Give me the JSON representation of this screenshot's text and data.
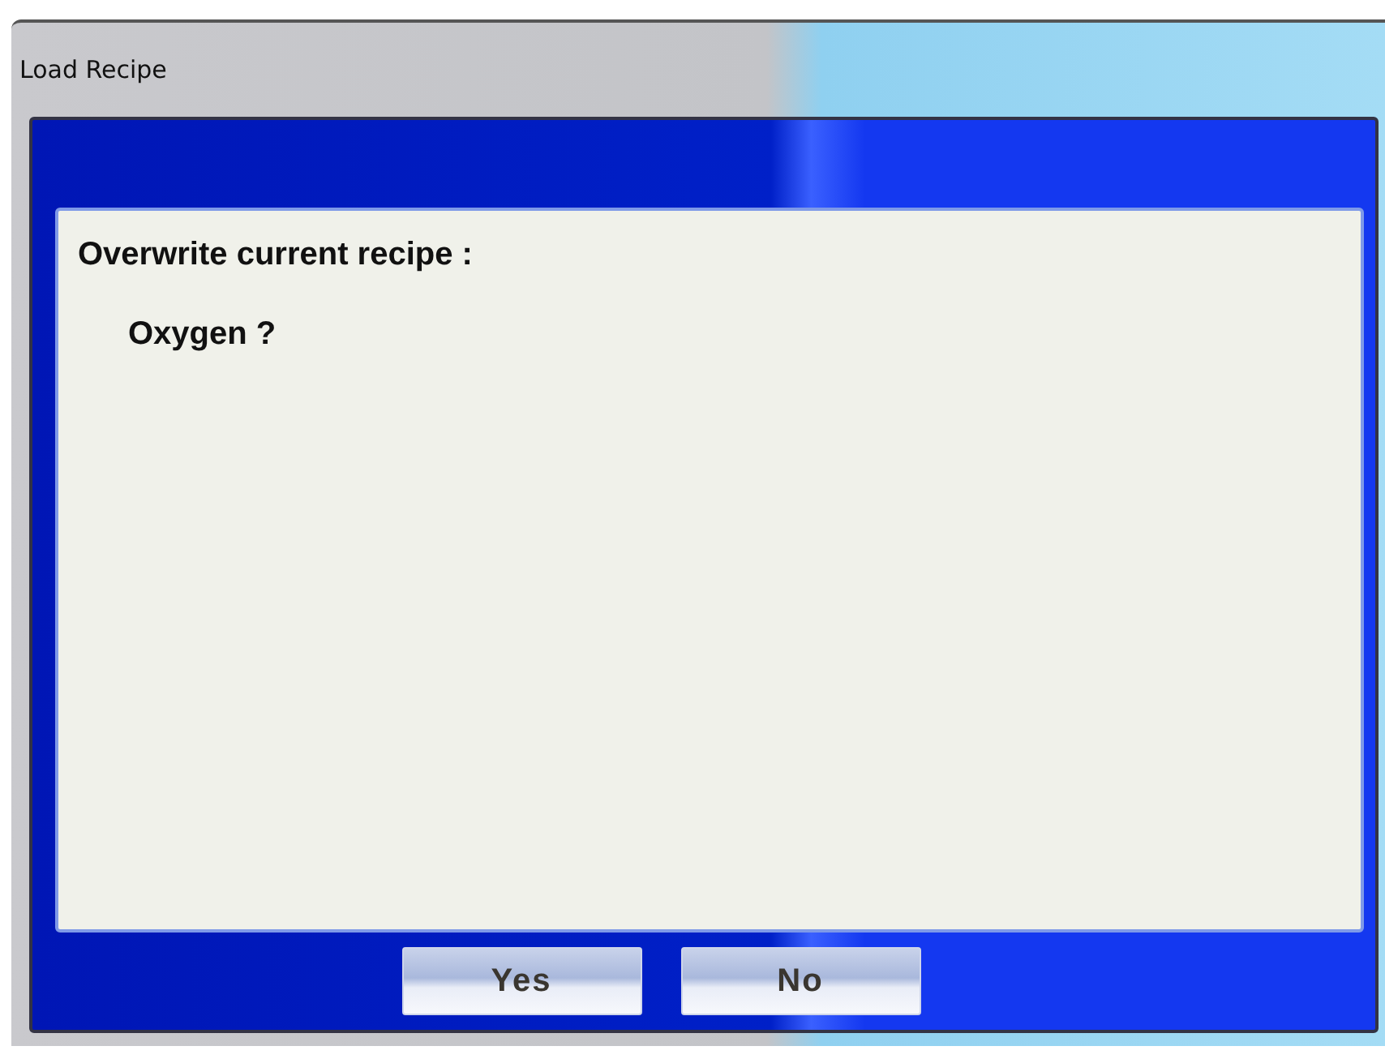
{
  "window": {
    "title": "Load Recipe"
  },
  "dialog": {
    "message": "Overwrite current recipe :",
    "recipe": "Oxygen ?"
  },
  "buttons": [
    {
      "label": "Yes"
    },
    {
      "label": "No"
    }
  ]
}
